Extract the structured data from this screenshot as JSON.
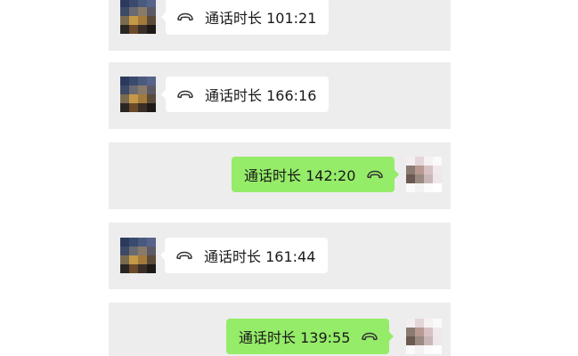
{
  "chat": {
    "messages": [
      {
        "direction": "incoming",
        "icon": "phone-hangup-icon",
        "text": "通话时长 101:21"
      },
      {
        "direction": "incoming",
        "icon": "phone-hangup-icon",
        "text": "通话时长 166:16"
      },
      {
        "direction": "outgoing",
        "icon": "phone-hangup-icon",
        "text": "通话时长 142:20"
      },
      {
        "direction": "incoming",
        "icon": "phone-hangup-icon",
        "text": "通话时长 161:44"
      },
      {
        "direction": "outgoing",
        "icon": "phone-hangup-icon",
        "text": "通话时长 139:55"
      }
    ]
  },
  "colors": {
    "panel_background": "#ededed",
    "incoming_bubble": "#ffffff",
    "outgoing_bubble": "#95ec69",
    "text": "#191919"
  }
}
